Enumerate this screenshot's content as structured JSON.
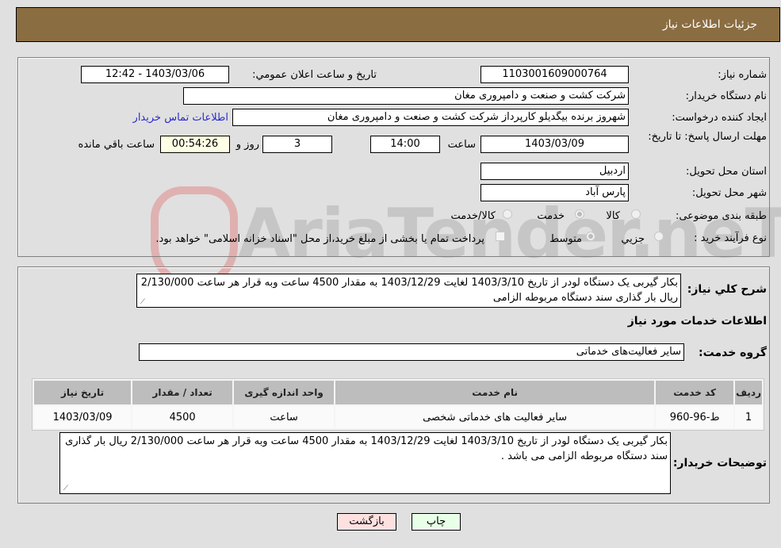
{
  "header": {
    "title": "جزئيات اطلاعات نیاز"
  },
  "form": {
    "need_number_label": "شماره نیاز:",
    "need_number": "1103001609000764",
    "announce_label": "تاریخ و ساعت اعلان عمومي:",
    "announce_value": "1403/03/06 - 12:42",
    "buyer_org_label": "نام دستگاه خريدار:",
    "buyer_org": "شرکت کشت و صنعت و دامپروری مغان",
    "creator_label": "ايجاد کننده درخواست:",
    "creator": "شهروز برنده بیگدیلو کارپرداز شرکت کشت و صنعت و دامپروری مغان",
    "contact_link": "اطلاعات تماس خریدار",
    "deadline_label": "مهلت ارسال پاسخ: تا تاریخ:",
    "deadline_date": "1403/03/09",
    "time_label": "ساعت",
    "deadline_time": "14:00",
    "days_value": "3",
    "days_label": "روز و",
    "remaining_time": "00:54:26",
    "remaining_label": "ساعت باقي مانده",
    "province_label": "استان محل تحويل:",
    "province": "اردبیل",
    "city_label": "شهر محل تحويل:",
    "city": "پارس آباد",
    "category_label": "طبقه بندی موضوعی:",
    "category_options": [
      "کالا",
      "خدمت",
      "کالا/خدمت"
    ],
    "category_selected": "خدمت",
    "process_label": "نوع فرآيند خريد :",
    "process_options": [
      "جزيي",
      "متوسط"
    ],
    "process_selected": "متوسط",
    "treasury_note": "پرداخت تمام یا بخشی از مبلغ خرید،از محل \"اسناد خزانه اسلامی\" خواهد بود."
  },
  "details": {
    "description_label": "شرح کلي نياز:",
    "description": "بکار گیربی یک دستگاه لودر از تاریخ 1403/3/10 لغایت 1403/12/29 به مقدار 4500 ساعت وبه قرار هر ساعت 2/130/000 ریال بار گذاری سند دستگاه مربوطه الزامی",
    "services_heading": "اطلاعات خدمات مورد نياز",
    "service_group_label": "گروه خدمت:",
    "service_group": "سایر فعالیت‌های خدماتی",
    "table": {
      "headers": [
        "رديف",
        "کد خدمت",
        "نام خدمت",
        "واحد اندازه گيری",
        "تعداد / مقدار",
        "تاريخ نياز"
      ],
      "rows": [
        [
          "1",
          "ط-96-960",
          "سایر فعالیت های خدماتی شخصی",
          "ساعت",
          "4500",
          "1403/03/09"
        ]
      ]
    },
    "buyer_notes_label": "توضيحات خريدار:",
    "buyer_notes": "بکار گیربی یک دستگاه لودر از تاریخ 1403/3/10 لغایت 1403/12/29 به مقدار 4500 ساعت وبه قرار هر ساعت 2/130/000 ریال بار گذاری سند دستگاه مربوطه الزامی می باشد ."
  },
  "buttons": {
    "print": "چاپ",
    "back": "بازگشت"
  },
  "watermark": {
    "text": "AriaTender.neT"
  },
  "colors": {
    "header_bg": "#8b6d42",
    "print_btn": "#e8ffe8",
    "back_btn": "#ffe0e0",
    "remaining_bg": "#ffffe6",
    "link": "#2a2acc"
  }
}
